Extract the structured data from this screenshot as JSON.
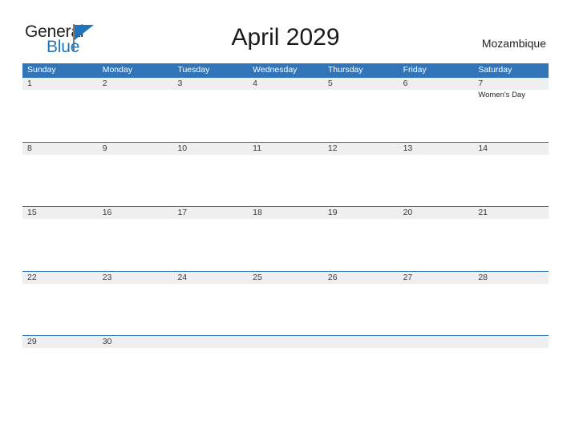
{
  "brand": {
    "name_part1": "General",
    "name_part2": "Blue",
    "flag_icon": "triangle-flag-icon",
    "color_primary": "#1f74bb",
    "color_text": "#231f20"
  },
  "header": {
    "title": "April 2029",
    "country": "Mozambique"
  },
  "calendar": {
    "header_color": "#3175b8",
    "divider_color": "#2e74b5",
    "band_color": "#efefef",
    "weekdays": [
      "Sunday",
      "Monday",
      "Tuesday",
      "Wednesday",
      "Thursday",
      "Friday",
      "Saturday"
    ],
    "weeks": [
      {
        "days": [
          {
            "date": "1",
            "events": []
          },
          {
            "date": "2",
            "events": []
          },
          {
            "date": "3",
            "events": []
          },
          {
            "date": "4",
            "events": []
          },
          {
            "date": "5",
            "events": []
          },
          {
            "date": "6",
            "events": []
          },
          {
            "date": "7",
            "events": [
              "Women's Day"
            ]
          }
        ]
      },
      {
        "days": [
          {
            "date": "8",
            "events": []
          },
          {
            "date": "9",
            "events": []
          },
          {
            "date": "10",
            "events": []
          },
          {
            "date": "11",
            "events": []
          },
          {
            "date": "12",
            "events": []
          },
          {
            "date": "13",
            "events": []
          },
          {
            "date": "14",
            "events": []
          }
        ]
      },
      {
        "days": [
          {
            "date": "15",
            "events": []
          },
          {
            "date": "16",
            "events": []
          },
          {
            "date": "17",
            "events": []
          },
          {
            "date": "18",
            "events": []
          },
          {
            "date": "19",
            "events": []
          },
          {
            "date": "20",
            "events": []
          },
          {
            "date": "21",
            "events": []
          }
        ]
      },
      {
        "days": [
          {
            "date": "22",
            "events": []
          },
          {
            "date": "23",
            "events": []
          },
          {
            "date": "24",
            "events": []
          },
          {
            "date": "25",
            "events": []
          },
          {
            "date": "26",
            "events": []
          },
          {
            "date": "27",
            "events": []
          },
          {
            "date": "28",
            "events": []
          }
        ]
      },
      {
        "days": [
          {
            "date": "29",
            "events": []
          },
          {
            "date": "30",
            "events": []
          },
          {
            "date": "",
            "events": []
          },
          {
            "date": "",
            "events": []
          },
          {
            "date": "",
            "events": []
          },
          {
            "date": "",
            "events": []
          },
          {
            "date": "",
            "events": []
          }
        ]
      }
    ]
  }
}
